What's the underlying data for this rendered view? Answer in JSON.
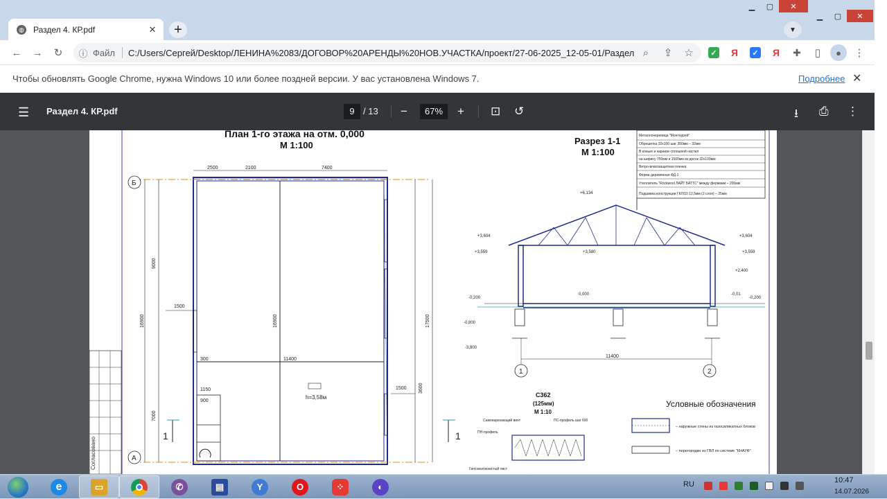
{
  "browser": {
    "tab_title": "Раздел 4. КР.pdf",
    "omnibox_label": "Файл",
    "url": "C:/Users/Сергей/Desktop/ЛЕНИНА%2083/ДОГОВОР%20АРЕНДЫ%20НОВ.УЧАСТКА/проект/27-06-2025_12-05-01/Раздел..."
  },
  "infobar": {
    "message": "Чтобы обновлять Google Chrome, нужна Windows 10 или более поздней версии. У вас установлена Windows 7.",
    "link": "Подробнее"
  },
  "pdf": {
    "title": "Раздел 4. КР.pdf",
    "current_page": "9",
    "total_pages": "/ 13",
    "zoom": "67%"
  },
  "drawing": {
    "plan_title": "План 1-го этажа на отм. 0,000",
    "plan_scale": "М 1:100",
    "section_title": "Разрез 1-1",
    "section_scale": "М 1:100",
    "node_title": "С362",
    "node_sub": "(125мм)",
    "node_scale": "М 1:10",
    "legend_title": "Условные обозначения",
    "legend_outer": "– наружные стены из газосиликатных блоков",
    "legend_partition": "– перегородки из ГВЛ по системе \"КНАУФ\"",
    "roof_layers": [
      "Металлочерепица \"Монтеррей\"",
      "Обрешетка 32х100 шаг 350мм  – 32мм",
      "В коньке и карнизе сплошной настил",
      "на ширину 750мм и 1500мм из досок 32х100мм",
      "Ветро-влагозащитная пленка",
      "Ферма деревянная ФД-1",
      "Утеплитель \"Rockwool ЛАЙТ БАТТС\" между фермами – 200мм",
      "Подшивка конструкции ГКЛ/10 12,5мм (2 слоя)  – 25мм"
    ],
    "plan_dims": [
      "2500",
      "2100",
      "7400",
      "1500",
      "16900",
      "11400",
      "300",
      "9000",
      "7000",
      "1500",
      "1150",
      "900",
      "17500",
      "3600",
      "2100"
    ],
    "room_height": "h=3,58м",
    "axis_a": "А",
    "axis_b": "Б",
    "axis_1": "1",
    "axis_2": "2",
    "section_marks": [
      "+6,134",
      "+3,604",
      "+3,559",
      "+3,580",
      "+3,604",
      "+3,559",
      "+2,400",
      "0,000",
      "-0,200",
      "-0,800",
      "-3,800",
      "-0,200",
      "-0,01"
    ],
    "section_width": "11400",
    "node_labels": [
      "ПН-профиль",
      "Самонарезающий винт",
      "ПС-профиль шаг 600",
      "Гипсоволокнистый лист"
    ],
    "side_label": "Согласовано"
  },
  "taskbar": {
    "lang": "RU",
    "time": "10:47",
    "date": "14.07.2026"
  }
}
